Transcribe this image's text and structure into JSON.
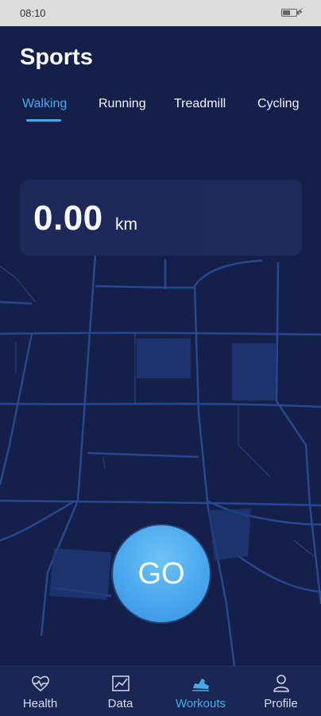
{
  "status_bar": {
    "time": "08:10"
  },
  "header": {
    "title": "Sports"
  },
  "tabs": [
    {
      "label": "Walking",
      "active": true
    },
    {
      "label": "Running",
      "active": false
    },
    {
      "label": "Treadmill",
      "active": false
    },
    {
      "label": "Cycling",
      "active": false
    }
  ],
  "distance": {
    "value": "0.00",
    "unit": "km"
  },
  "go_button": {
    "label": "GO"
  },
  "bottom_nav": [
    {
      "label": "Health",
      "icon": "heart-pulse-icon",
      "active": false
    },
    {
      "label": "Data",
      "icon": "chart-icon",
      "active": false
    },
    {
      "label": "Workouts",
      "icon": "shoe-icon",
      "active": true
    },
    {
      "label": "Profile",
      "icon": "person-icon",
      "active": false
    }
  ],
  "colors": {
    "background": "#15204a",
    "accent": "#4aa8ea",
    "card": "#1e2a5c",
    "road": "#2a4f9a"
  }
}
